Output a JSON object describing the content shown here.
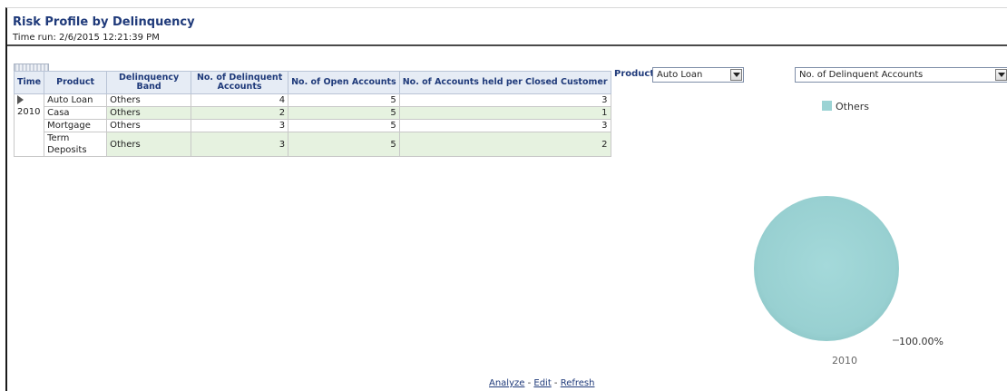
{
  "report": {
    "title": "Risk Profile by Delinquency",
    "time_run": "Time run: 2/6/2015 12:21:39 PM"
  },
  "table": {
    "headers": {
      "time": "Time",
      "product": "Product",
      "band": "Delinquency Band",
      "delinquent": "No. of Delinquent Accounts",
      "open": "No. of Open Accounts",
      "closed": "No. of Accounts held per Closed Customer"
    },
    "year": "2010",
    "rows": [
      {
        "product": "Auto Loan",
        "band": "Others",
        "delinquent": "4",
        "open": "5",
        "closed": "3"
      },
      {
        "product": "Casa",
        "band": "Others",
        "delinquent": "2",
        "open": "5",
        "closed": "1"
      },
      {
        "product": "Mortgage",
        "band": "Others",
        "delinquent": "3",
        "open": "5",
        "closed": "3"
      },
      {
        "product": "Term Deposits",
        "band": "Others",
        "delinquent": "3",
        "open": "5",
        "closed": "2"
      }
    ]
  },
  "filters": {
    "product_label": "Product",
    "product_value": "Auto Loan",
    "measure_value": "No. of Delinquent Accounts"
  },
  "chart_data": {
    "type": "pie",
    "categories": [
      "Others"
    ],
    "values": [
      100
    ],
    "slice_labels": [
      "100.00%"
    ],
    "xlabel": "2010",
    "legend": [
      "Others"
    ],
    "legend_position": "top",
    "colors": [
      "#9bd3d4"
    ]
  },
  "footer": {
    "analyze": "Analyze",
    "sep1": " - ",
    "edit": "Edit",
    "sep2": " - ",
    "refresh": "Refresh"
  },
  "icons": {
    "expand": "expand-triangle-icon",
    "dropdown": "chevron-down-icon"
  }
}
